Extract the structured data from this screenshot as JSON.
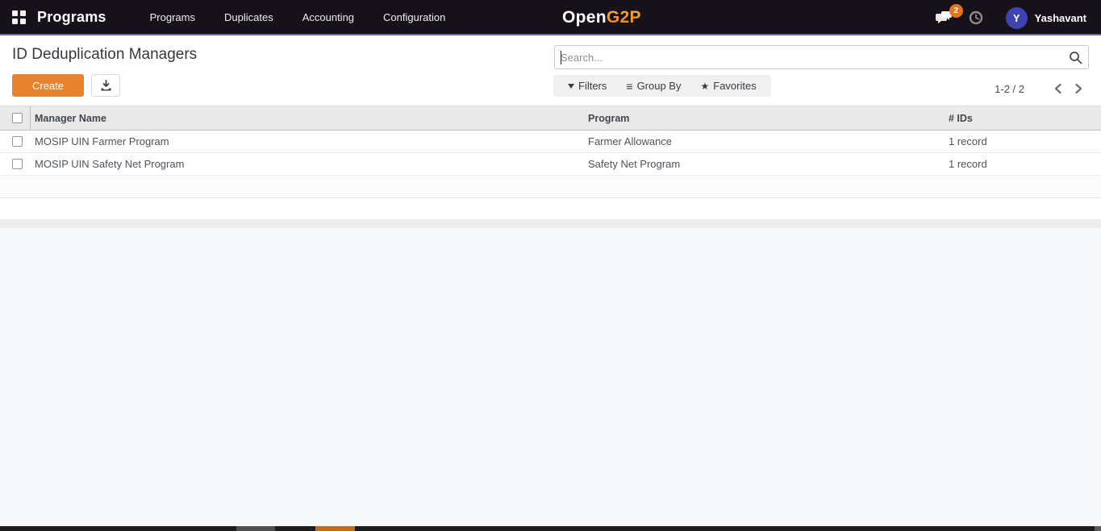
{
  "nav": {
    "app_title": "Programs",
    "menu_items": {
      "programs": "Programs",
      "duplicates": "Duplicates",
      "accounting": "Accounting",
      "configuration": "Configuration"
    },
    "logo": {
      "part1": "Open",
      "part2": "G2P"
    },
    "messages_badge": "2",
    "user": {
      "initial": "Y",
      "name": "Yashavant"
    }
  },
  "header": {
    "page_title": "ID Deduplication Managers",
    "create_label": "Create"
  },
  "search": {
    "placeholder": "Search..."
  },
  "controls": {
    "filters_label": "Filters",
    "group_by_label": "Group By",
    "group_by_icon": "≡",
    "favorites_label": "Favorites",
    "favorites_icon": "★"
  },
  "pagination": {
    "range": "1-2 / 2"
  },
  "table": {
    "columns": {
      "manager_name": "Manager Name",
      "program": "Program",
      "ids": "# IDs"
    },
    "rows": [
      {
        "manager_name": "MOSIP UIN Farmer Program",
        "program": "Farmer Allowance",
        "ids": "1 record"
      },
      {
        "manager_name": "MOSIP UIN Safety Net Program",
        "program": "Safety Net Program",
        "ids": "1 record"
      }
    ]
  },
  "colors": {
    "topbar_bg": "#17121a",
    "topbar_underline": "#6a68a0",
    "accent_orange": "#e8822c",
    "badge_orange": "#e2761f",
    "avatar_blue": "#3d44b2",
    "logo_orange": "#f7941e",
    "header_row_bg": "#e9e9ea"
  }
}
